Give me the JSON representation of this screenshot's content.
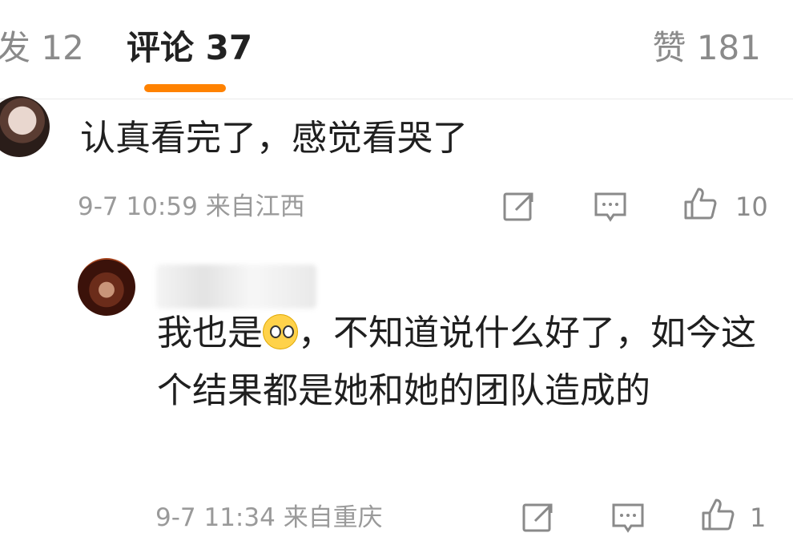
{
  "tabs": {
    "repost": "发 12",
    "comments": "评论 37",
    "likes": "赞 181"
  },
  "comment": {
    "text": "认真看完了，感觉看哭了",
    "time": "9-7 10:59",
    "location": "来自江西",
    "like_count": "10"
  },
  "reply": {
    "text_before_emoji": "我也是",
    "emoji": "crying-face-emoji",
    "text_after_emoji": "，不知道说什么好了，如今这个结果都是她和她的团队造成的",
    "time": "9-7 11:34",
    "location": "来自重庆",
    "like_count": "1"
  },
  "colors": {
    "accent": "#ff8200",
    "meta_gray": "#9a9a9a",
    "text": "#1f1f1f"
  }
}
